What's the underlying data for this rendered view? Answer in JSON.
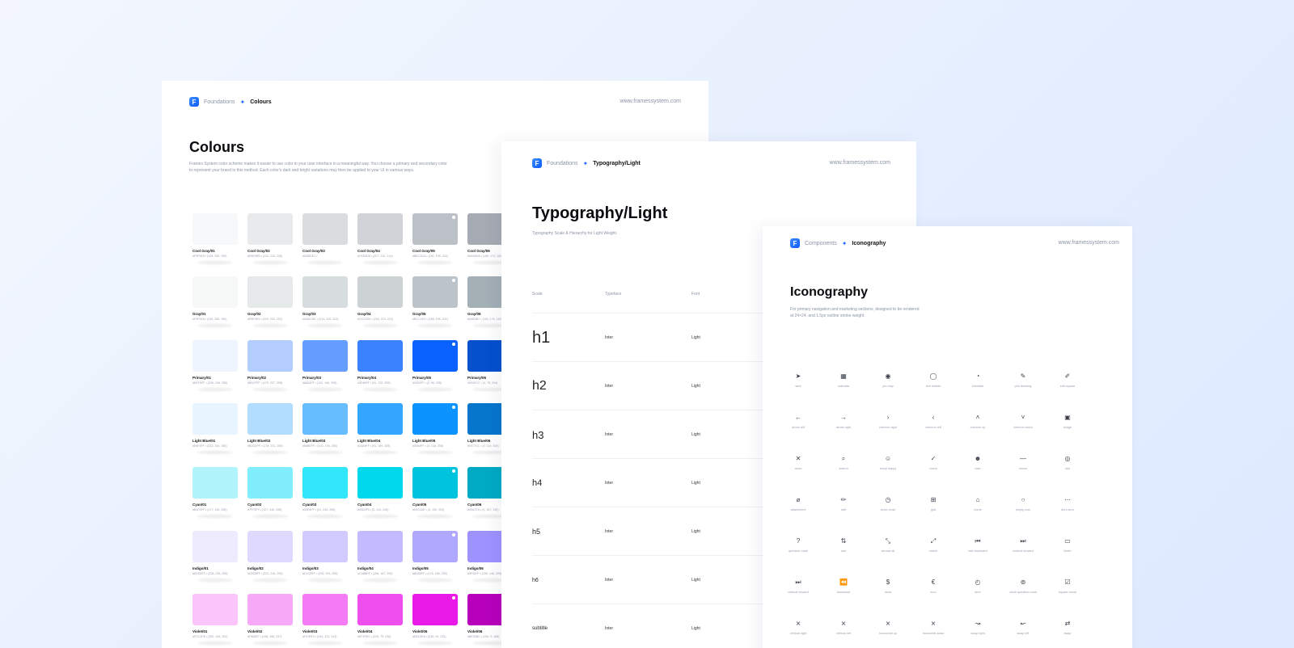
{
  "colours": {
    "crumb_parent": "Foundations",
    "crumb_current": "Colours",
    "url": "www.framessystem.com",
    "title": "Colours",
    "description": "Frames System color scheme makes it easier to use color in your user interface in a meaningful way. You choose a primary and secondary color to represent your brand in this method. Each color's dark and bright variations may then be applied to your UI in various ways.",
    "rows": [
      [
        {
          "name": "Cool Gray/01",
          "code": "#F9FAFA  •  (249, 250, 250)",
          "color": "#f7f8f9",
          "dot": false
        },
        {
          "name": "Cool Gray/02",
          "code": "#E8E9EB  •  (232, 233, 235)",
          "color": "#e9eaec",
          "dot": false
        },
        {
          "name": "Cool Gray/03",
          "code": "#D9DDE1  •",
          "color": "#dadde0",
          "dot": false
        },
        {
          "name": "Cool Gray/04",
          "code": "#CFD2D6  •  (207, 210, 214)",
          "color": "#d0d3d7",
          "dot": false
        },
        {
          "name": "Cool Gray/05",
          "code": "#BEC3CA  •  (190, 195, 202)",
          "color": "#bcc1c8",
          "dot": true
        },
        {
          "name": "Cool Gray/06",
          "code": "#A9AEB6  •  (169, 174, 182)",
          "color": "#a6abb3",
          "dot": false
        }
      ],
      [
        {
          "name": "Gray/01",
          "code": "#F9FAFA  •  (249, 250, 250)",
          "color": "#f7f8f8",
          "dot": false
        },
        {
          "name": "Gray/02",
          "code": "#E5E9E9  •  (229, 233, 233)",
          "color": "#e6e9e9",
          "dot": false
        },
        {
          "name": "Gray/03",
          "code": "#D6DCDE  •  (214, 220, 222)",
          "color": "#d7dcde",
          "dot": false
        },
        {
          "name": "Gray/04",
          "code": "#CCD2D4  •  (204, 210, 212)",
          "color": "#cdd2d4",
          "dot": false
        },
        {
          "name": "Gray/05",
          "code": "#BCC4C9  •  (188, 196, 201)",
          "color": "#bcc4c9",
          "dot": true
        },
        {
          "name": "Gray/06",
          "code": "#A5B0B7  •  (165, 176, 183)",
          "color": "#a4afb6",
          "dot": false
        }
      ],
      [
        {
          "name": "Primary/01",
          "code": "#EEF5FF  •  (238, 245, 255)",
          "color": "#eef5ff",
          "dot": false
        },
        {
          "name": "Primary/02",
          "code": "#B3CFFF  •  (179, 207, 255)",
          "color": "#b3cdff",
          "dot": false
        },
        {
          "name": "Primary/03",
          "code": "#66A0FF  •  (102, 160, 255)",
          "color": "#669eff",
          "dot": false
        },
        {
          "name": "Primary/04",
          "code": "#3D84FF  •  (61, 132, 255)",
          "color": "#3b82ff",
          "dot": false
        },
        {
          "name": "Primary/05",
          "code": "#0062FF  •  (0, 98, 255)",
          "color": "#0962ff",
          "dot": true
        },
        {
          "name": "Primary/06",
          "code": "#004ECC  •  (0, 78, 204)",
          "color": "#0450cd",
          "dot": false
        }
      ],
      [
        {
          "name": "Light Blue/01",
          "code": "#E8F4FF  •  (232, 244, 255)",
          "color": "#e8f4ff",
          "dot": false
        },
        {
          "name": "Light Blue/02",
          "code": "#B2DDFF  •  (178, 221, 255)",
          "color": "#b2ddff",
          "dot": false
        },
        {
          "name": "Light Blue/03",
          "code": "#66BEFF  •  (102, 190, 255)",
          "color": "#66bdff",
          "dot": false
        },
        {
          "name": "Light Blue/04",
          "code": "#33A9FF  •  (51, 169, 255)",
          "color": "#33a7ff",
          "dot": false
        },
        {
          "name": "Light Blue/05",
          "code": "#0094FF  •  (0, 148, 255)",
          "color": "#0b93ff",
          "dot": true
        },
        {
          "name": "Light Blue/06",
          "code": "#0077CC  •  (0, 119, 204)",
          "color": "#0676cc",
          "dot": false
        }
      ],
      [
        {
          "name": "Cyan/01",
          "code": "#B1F5FF  •  (177, 245, 255)",
          "color": "#b2f4fc",
          "dot": false
        },
        {
          "name": "Cyan/02",
          "code": "#7FF0FF  •  (127, 240, 255)",
          "color": "#80eefc",
          "dot": false
        },
        {
          "name": "Cyan/03",
          "code": "#33E9FF  •  (51, 233, 255)",
          "color": "#33e7fb",
          "dot": false
        },
        {
          "name": "Cyan/04",
          "code": "#00D2F0  •  (0, 210, 240)",
          "color": "#00d8ee",
          "dot": false
        },
        {
          "name": "Cyan/05",
          "code": "#00C1DE  •  (0, 193, 222)",
          "color": "#00c3de",
          "dot": true
        },
        {
          "name": "Cyan/06",
          "code": "#00A7C0  •  (0, 167, 192)",
          "color": "#00aac4",
          "dot": false
        }
      ],
      [
        {
          "name": "Indigo/01",
          "code": "#EEEBFF  •  (238, 235, 255)",
          "color": "#eeebff",
          "dot": false
        },
        {
          "name": "Indigo/02",
          "code": "#DED8FF  •  (222, 216, 255)",
          "color": "#dfd9ff",
          "dot": false
        },
        {
          "name": "Indigo/03",
          "code": "#D1CBFF  •  (209, 203, 255)",
          "color": "#d1caff",
          "dot": false
        },
        {
          "name": "Indigo/04",
          "code": "#C4BBFF  •  (196, 187, 255)",
          "color": "#c3bbff",
          "dot": false
        },
        {
          "name": "Indigo/05",
          "code": "#B0A6FF  •  (176, 166, 255)",
          "color": "#b0a8ff",
          "dot": true
        },
        {
          "name": "Indigo/06",
          "code": "#9F92FF  •  (159, 146, 255)",
          "color": "#9e92ff",
          "dot": false
        }
      ],
      [
        {
          "name": "Violet/01",
          "code": "#FCC4FB  •  (252, 196, 251)",
          "color": "#fbc4fb",
          "dot": false
        },
        {
          "name": "Violet/02",
          "code": "#F8A8F7  •  (248, 168, 247)",
          "color": "#f7a8f7",
          "dot": false
        },
        {
          "name": "Violet/03",
          "code": "#F47BF3  •  (244, 123, 243)",
          "color": "#f47bf3",
          "dot": false
        },
        {
          "name": "Violet/04",
          "code": "#EF4FEC  •  (239, 79, 236)",
          "color": "#ee4eee",
          "dot": false
        },
        {
          "name": "Violet/05",
          "code": "#EB1DE8  •  (235, 29, 232)",
          "color": "#e919e8",
          "dot": true
        },
        {
          "name": "Violet/06",
          "code": "#BE00BC  •  (190, 0, 188)",
          "color": "#b800bc",
          "dot": false
        }
      ]
    ]
  },
  "typography": {
    "crumb_parent": "Foundations",
    "crumb_current": "Typography/Light",
    "url": "www.framessystem.com",
    "title": "Typography/Light",
    "subtitle": "Typography Scale & Hierarchy for Light Weight.",
    "headers": {
      "scale": "Scale",
      "typeface": "Typeface",
      "font": "Font"
    },
    "rows": [
      {
        "scale": "h1",
        "typeface": "Inter",
        "font": "Light"
      },
      {
        "scale": "h2",
        "typeface": "Inter",
        "font": "Light"
      },
      {
        "scale": "h3",
        "typeface": "Inter",
        "font": "Light"
      },
      {
        "scale": "h4",
        "typeface": "Inter",
        "font": "Light"
      },
      {
        "scale": "h5",
        "typeface": "Inter",
        "font": "Light"
      },
      {
        "scale": "h6",
        "typeface": "Inter",
        "font": "Light"
      },
      {
        "scale": "subtitle",
        "typeface": "Inter",
        "font": "Light"
      }
    ]
  },
  "iconography": {
    "crumb_parent": "Components",
    "crumb_current": "Iconography",
    "url": "www.framessystem.com",
    "title": "Iconography",
    "description": "For primary navigation and marketing sections, designed to be rendered at 24×24, and 1.5px outline stroke weight.",
    "rows": [
      [
        {
          "glyph": "➤",
          "label": "sent",
          "name": "sent-icon"
        },
        {
          "glyph": "▦",
          "label": "calendar",
          "name": "calendar-icon"
        },
        {
          "glyph": "◉",
          "label": "pin map",
          "name": "pin-map-icon"
        },
        {
          "glyph": "◯",
          "label": "text bubble",
          "name": "text-bubble-icon"
        },
        {
          "glyph": "◔",
          "label": "checklist",
          "name": "checklist-icon"
        },
        {
          "glyph": "✎",
          "label": "pen drawing",
          "name": "pen-drawing-icon"
        },
        {
          "glyph": "✐",
          "label": "edit square",
          "name": "edit-square-icon"
        }
      ],
      [
        {
          "glyph": "←",
          "label": "arrow left",
          "name": "arrow-left-icon"
        },
        {
          "glyph": "→",
          "label": "arrow right",
          "name": "arrow-right-icon"
        },
        {
          "glyph": "›",
          "label": "chevron right",
          "name": "chevron-right-icon"
        },
        {
          "glyph": "‹",
          "label": "chevron left",
          "name": "chevron-left-icon"
        },
        {
          "glyph": "˄",
          "label": "chevron up",
          "name": "chevron-up-icon"
        },
        {
          "glyph": "˅",
          "label": "chevron down",
          "name": "chevron-down-icon"
        },
        {
          "glyph": "▣",
          "label": "image",
          "name": "image-icon"
        }
      ],
      [
        {
          "glyph": "✕",
          "label": "close",
          "name": "close-icon"
        },
        {
          "glyph": "⌕",
          "label": "search",
          "name": "search-icon"
        },
        {
          "glyph": "☺",
          "label": "emoji happy",
          "name": "emoji-happy-icon"
        },
        {
          "glyph": "✓",
          "label": "check",
          "name": "check-icon"
        },
        {
          "glyph": "☻",
          "label": "user",
          "name": "user-icon"
        },
        {
          "glyph": "—",
          "label": "minus",
          "name": "minus-icon"
        },
        {
          "glyph": "◎",
          "label": "eye",
          "name": "eye-icon"
        }
      ],
      [
        {
          "glyph": "⌀",
          "label": "attachment",
          "name": "attachment-icon"
        },
        {
          "glyph": "✏",
          "label": "edit",
          "name": "edit-icon"
        },
        {
          "glyph": "◷",
          "label": "circle close",
          "name": "circle-close-icon"
        },
        {
          "glyph": "⊞",
          "label": "grid",
          "name": "grid-icon"
        },
        {
          "glyph": "⌂",
          "label": "home",
          "name": "home-icon"
        },
        {
          "glyph": "○",
          "label": "empty icon",
          "name": "empty-icon"
        },
        {
          "glyph": "⋯",
          "label": "dot menu",
          "name": "dot-menu-icon"
        }
      ],
      [
        {
          "glyph": "?",
          "label": "question mark",
          "name": "question-mark-icon"
        },
        {
          "glyph": "⇅",
          "label": "sort",
          "name": "sort-icon"
        },
        {
          "glyph": "⤡",
          "label": "arrows all",
          "name": "arrows-all-icon"
        },
        {
          "glyph": "⤢",
          "label": "shrink",
          "name": "shrink-icon"
        },
        {
          "glyph": "⏮",
          "label": "fast backward",
          "name": "fast-backward-icon"
        },
        {
          "glyph": "⏭",
          "label": "vertical forward",
          "name": "vertical-forward-icon"
        },
        {
          "glyph": "▭",
          "label": "folder",
          "name": "folder-icon"
        }
      ],
      [
        {
          "glyph": "⏭",
          "label": "vertical forward",
          "name": "vertical-forward-icon-2"
        },
        {
          "glyph": "⏪",
          "label": "backward",
          "name": "backward-icon"
        },
        {
          "glyph": "$",
          "label": "dolar",
          "name": "dolar-icon"
        },
        {
          "glyph": "€",
          "label": "euro",
          "name": "euro-icon"
        },
        {
          "glyph": "◴",
          "label": "time",
          "name": "time-icon"
        },
        {
          "glyph": "⊚",
          "label": "circle question mark",
          "name": "circle-question-mark-icon"
        },
        {
          "glyph": "☑",
          "label": "square check",
          "name": "square-check-icon"
        }
      ],
      [
        {
          "glyph": "⨯",
          "label": "vertical right",
          "name": "vertical-right-icon"
        },
        {
          "glyph": "⨯",
          "label": "vertical left",
          "name": "vertical-left-icon"
        },
        {
          "glyph": "⨯",
          "label": "horizontal up",
          "name": "horizontal-up-icon"
        },
        {
          "glyph": "⨯",
          "label": "horizontal down",
          "name": "horizontal-down-icon"
        },
        {
          "glyph": "↝",
          "label": "swap right",
          "name": "swap-right-icon"
        },
        {
          "glyph": "↜",
          "label": "swap left",
          "name": "swap-left-icon"
        },
        {
          "glyph": "⇄",
          "label": "swap",
          "name": "swap-icon"
        }
      ]
    ]
  }
}
